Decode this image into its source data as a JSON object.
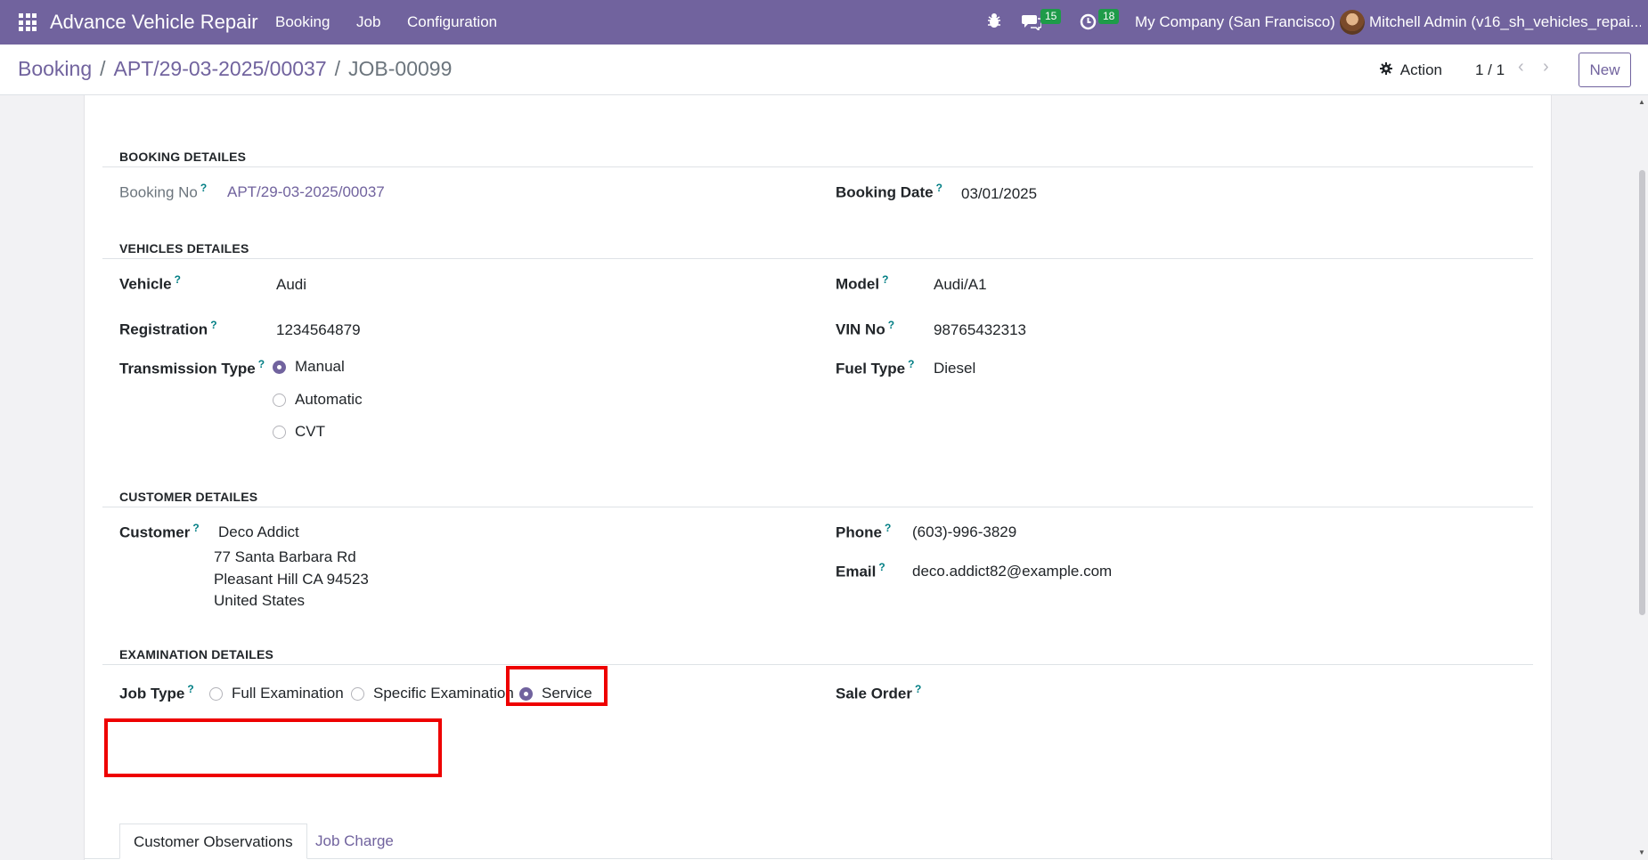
{
  "navbar": {
    "app_name": "Advance Vehicle Repair",
    "menu": [
      "Booking",
      "Job",
      "Configuration"
    ],
    "messages_count": "15",
    "activities_count": "18",
    "company": "My Company (San Francisco)",
    "user": "Mitchell Admin (v16_sh_vehicles_repai..."
  },
  "control": {
    "breadcrumb": [
      "Booking",
      "APT/29-03-2025/00037",
      "JOB-00099"
    ],
    "separator": "/",
    "action_label": "Action",
    "pager": "1 / 1",
    "new_label": "New"
  },
  "form": {
    "help_mark": "?",
    "booking": {
      "title": "BOOKING DETAILES",
      "booking_no_label": "Booking No",
      "booking_no": "APT/29-03-2025/00037",
      "booking_date_label": "Booking Date",
      "booking_date": "03/01/2025"
    },
    "vehicle": {
      "title": "VEHICLES DETAILES",
      "vehicle_label": "Vehicle",
      "vehicle": "Audi",
      "model_label": "Model",
      "model": "Audi/A1",
      "registration_label": "Registration",
      "registration": "1234564879",
      "vin_label": "VIN No",
      "vin": "98765432313",
      "transmission_label": "Transmission Type",
      "transmission_options": [
        "Manual",
        "Automatic",
        "CVT"
      ],
      "transmission_selected": "Manual",
      "fuel_label": "Fuel Type",
      "fuel": "Diesel"
    },
    "customer": {
      "title": "CUSTOMER DETAILES",
      "customer_label": "Customer",
      "name": "Deco Addict",
      "address_line1": "77 Santa Barbara Rd",
      "address_line2": "Pleasant Hill CA 94523",
      "country": "United States",
      "phone_label": "Phone",
      "phone": "(603)-996-3829",
      "email_label": "Email",
      "email": "deco.addict82@example.com"
    },
    "examination": {
      "title": "EXAMINATION DETAILES",
      "job_type_label": "Job Type",
      "job_type_options": [
        "Full Examination",
        "Specific Examination",
        "Service"
      ],
      "job_type_selected": "Service",
      "sale_order_label": "Sale Order"
    },
    "tabs": [
      "Customer Observations",
      "Job Charge"
    ],
    "active_tab": "Customer Observations"
  },
  "colors": {
    "brand": "#71639e",
    "highlight": "#ee0000",
    "badge": "#1e9b49",
    "help": "#017e84"
  }
}
